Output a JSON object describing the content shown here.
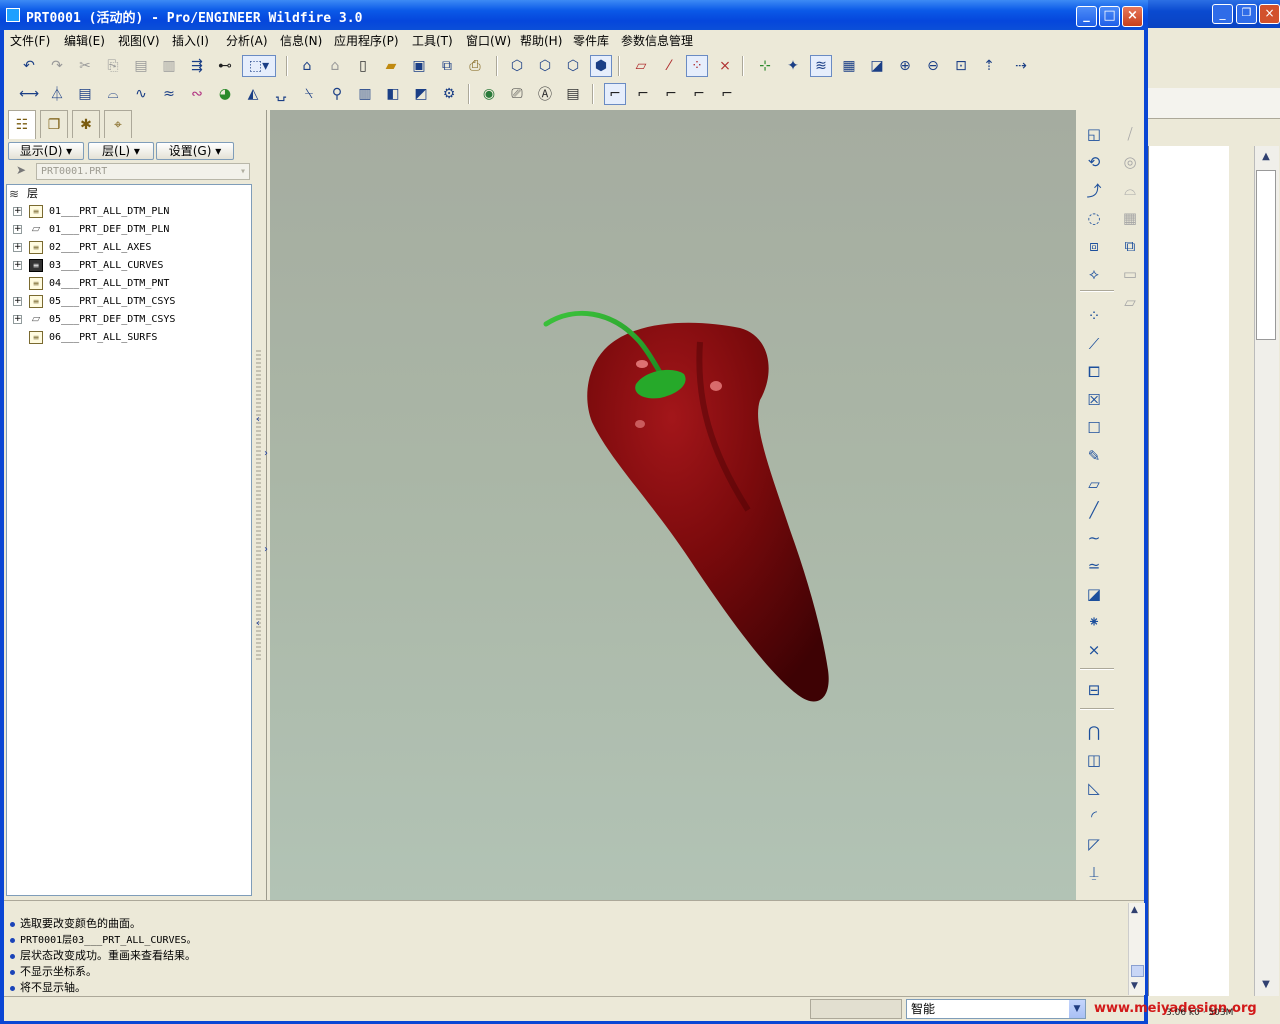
{
  "window": {
    "title": "PRT0001 (活动的) - Pro/ENGINEER Wildfire 3.0",
    "controls": {
      "minimize": "_",
      "maximize": "□",
      "close": "×"
    }
  },
  "menu": [
    "文件(F)",
    "编辑(E)",
    "视图(V)",
    "插入(I)",
    "分析(A)",
    "信息(N)",
    "应用程序(P)",
    "工具(T)",
    "窗口(W)",
    "帮助(H)",
    "零件库",
    "参数信息管理"
  ],
  "panel": {
    "buttons": {
      "show": "显示(D) ▾",
      "layer": "层(L) ▾",
      "settings": "设置(G) ▾"
    },
    "selector": "PRT0001.PRT",
    "root_label": "层",
    "layers": [
      {
        "name": "01___PRT_ALL_DTM_PLN",
        "icon": "layer-icon",
        "expandable": true
      },
      {
        "name": "01___PRT_DEF_DTM_PLN",
        "icon": "plane-layer-icon",
        "expandable": true
      },
      {
        "name": "02___PRT_ALL_AXES",
        "icon": "layer-icon",
        "expandable": true
      },
      {
        "name": "03___PRT_ALL_CURVES",
        "icon": "hidden-layer-icon",
        "expandable": true
      },
      {
        "name": "04___PRT_ALL_DTM_PNT",
        "icon": "layer-icon",
        "expandable": false
      },
      {
        "name": "05___PRT_ALL_DTM_CSYS",
        "icon": "layer-icon",
        "expandable": true
      },
      {
        "name": "05___PRT_DEF_DTM_CSYS",
        "icon": "plane-layer-icon",
        "expandable": true
      },
      {
        "name": "06___PRT_ALL_SURFS",
        "icon": "layer-icon",
        "expandable": false
      }
    ]
  },
  "messages": [
    "选取要改变颜色的曲面。",
    "PRT0001层03___PRT_ALL_CURVES。",
    "层状态改变成功。重画来查看结果。",
    "不显示坐标系。",
    "将不显示轴。"
  ],
  "status": {
    "filter": "智能",
    "watermark": "www.meiyadesign.org",
    "memory": "3.06 k0 · 503M"
  },
  "colors": {
    "pepper": "#7a0a0a",
    "stem": "#2fae2f",
    "viewport_top": "#a5aca0",
    "viewport_bottom": "#b2c3b5",
    "titlebar": "#0b5ae8"
  },
  "toolbar_icons_row1": [
    "undo-icon",
    "redo-icon",
    "cut-icon",
    "copy-icon",
    "paste-icon",
    "paste-special-icon",
    "regenerate-icon",
    "find-icon",
    "select-box-icon",
    "open-model-icon",
    "close-model-icon",
    "new-icon",
    "open-icon",
    "save-icon",
    "save-copy-icon",
    "print-icon",
    "shading-wireframe-icon",
    "hidden-line-icon",
    "no-hidden-icon",
    "shading-icon",
    "datum-planes-icon",
    "datum-axes-icon",
    "datum-points-icon",
    "csys-icon",
    "spin-center-icon",
    "annotations-icon",
    "layers-icon",
    "view-manager-icon",
    "repaint-icon",
    "zoom-in-icon",
    "zoom-out-icon",
    "refit-icon",
    "orient-icon",
    "saved-views-icon"
  ],
  "toolbar_icons_row2": [
    "measure-icon",
    "mass-prop-icon",
    "model-tree-icon",
    "section-icon",
    "curvature-icon",
    "draft-icon",
    "shading-analysis-icon",
    "color-map-icon",
    "reflection-icon",
    "lights-icon",
    "texture-icon",
    "probe-icon",
    "table-icon",
    "render-icon",
    "render-region-icon",
    "appearance-icon",
    "globe-icon",
    "camera-icon",
    "text-icon",
    "config-icon",
    "round-set-icon",
    "round-edge-icon",
    "round-auto-icon",
    "round-full-icon",
    "round-variable-icon"
  ],
  "right_toolbar_icons": [
    "extrude-icon",
    "mirror-icon",
    "revolve-icon",
    "offset-icon",
    "sweep-icon",
    "thicken-icon",
    "blend-icon",
    "pattern-icon",
    "merge-icon",
    "trim-icon",
    "boundary-icon",
    "solidify-icon",
    "datum-point-icon",
    "datum-axis-icon",
    "copy-geom-icon",
    "shrinkwrap-icon",
    "style-icon",
    "hole-icon",
    "datum-plane-icon",
    "axis-icon",
    "curve-icon",
    "sketch-icon",
    "sketched-curve-icon",
    "point-icon",
    "csys-tool-icon",
    "analysis-feature-icon",
    "annotation-feature-icon",
    "shell-icon",
    "rib-icon",
    "draft-tool-icon",
    "round-tool-icon",
    "chamfer-icon"
  ]
}
